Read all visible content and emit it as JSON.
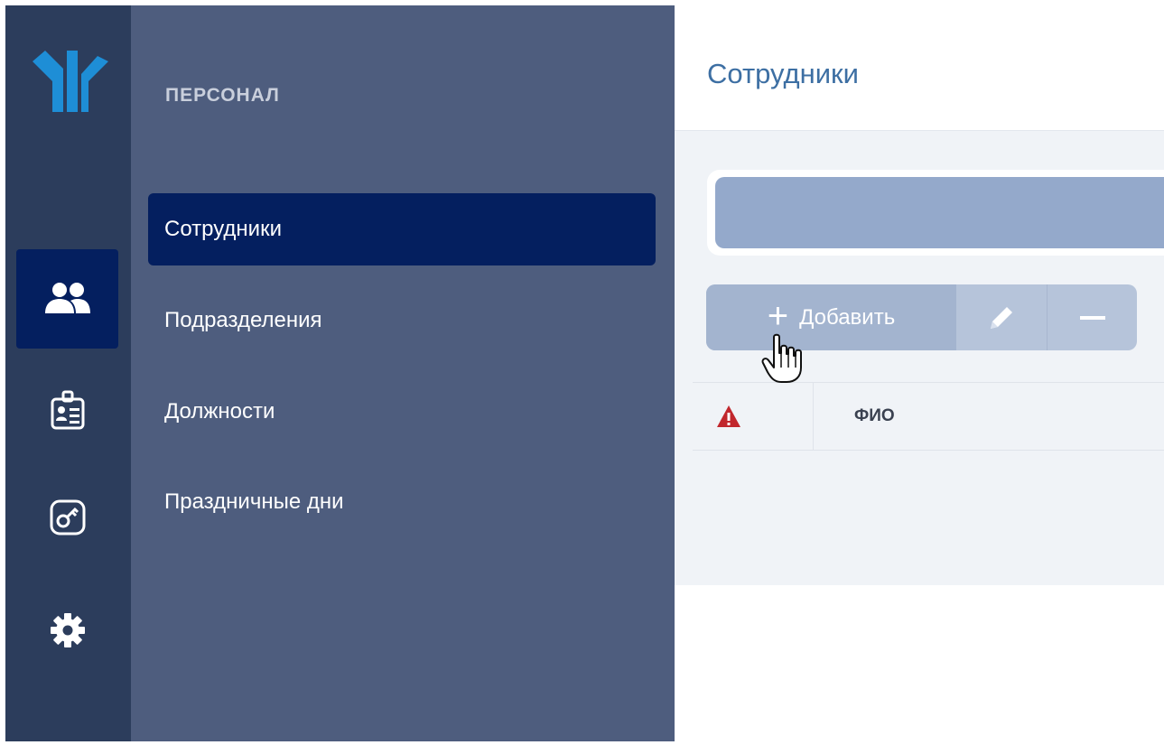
{
  "sidebar": {
    "rail": [
      {
        "icon": "users-icon",
        "active": true
      },
      {
        "icon": "id-card-icon",
        "active": false
      },
      {
        "icon": "key-icon",
        "active": false
      },
      {
        "icon": "gear-icon",
        "active": false
      }
    ],
    "section_title": "ПЕРСОНАЛ",
    "items": [
      {
        "label": "Сотрудники",
        "active": true
      },
      {
        "label": "Подразделения",
        "active": false
      },
      {
        "label": "Должности",
        "active": false
      },
      {
        "label": "Праздничные дни",
        "active": false
      }
    ]
  },
  "main": {
    "title": "Сотрудники",
    "toolbar": {
      "add_label": "Добавить",
      "add_icon": "plus-icon",
      "edit_icon": "pencil-icon",
      "remove_icon": "minus-icon"
    },
    "table": {
      "columns": [
        {
          "icon": "warning-icon"
        },
        {
          "label": "ФИО"
        }
      ],
      "rows": []
    }
  },
  "colors": {
    "rail_bg": "#2c3d5c",
    "submenu_bg": "#4e5d7e",
    "active_bg": "#041f5f",
    "title_color": "#3d6fa3",
    "accent_logo": "#1e8ed6",
    "warning": "#c1272d"
  }
}
